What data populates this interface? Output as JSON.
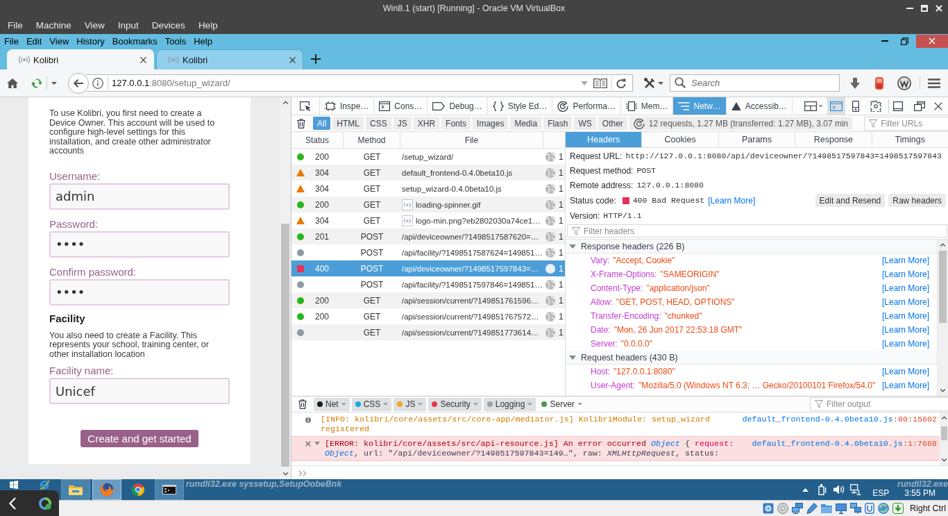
{
  "vm_window": {
    "title": "Win8.1 (start) [Running] - Oracle VM VirtualBox",
    "menu": [
      "File",
      "Machine",
      "View",
      "Input",
      "Devices",
      "Help"
    ]
  },
  "browser": {
    "menu": [
      "File",
      "Edit",
      "View",
      "History",
      "Bookmarks",
      "Tools",
      "Help"
    ],
    "tabs": [
      {
        "label": "Kolibri",
        "selected": true
      },
      {
        "label": "Kolibri",
        "selected": false
      }
    ],
    "address": {
      "host": "127.0.0.1",
      "rest": ":8080/setup_wizard/"
    },
    "search": {
      "placeholder": "Search"
    }
  },
  "setup_form": {
    "intro": "To use Kolibri, you first need to create a Device Owner. This account will be used to configure high-level settings for this installation, and create other administrator accounts",
    "owner_fields": [
      {
        "label": "Username:",
        "value": "admin"
      },
      {
        "label": "Password:",
        "value": "••••"
      },
      {
        "label": "Confirm password:",
        "value": "••••"
      }
    ],
    "facility_heading": "Facility",
    "facility_text": "You also need to create a Facility. This represents your school, training center, or other installation location",
    "facility_fields": [
      {
        "label": "Facility name:",
        "value": "Unicef"
      }
    ],
    "submit": "Create and get started"
  },
  "devtools": {
    "tools": [
      {
        "label": "Inspe…",
        "selected": false
      },
      {
        "label": "Cons…",
        "selected": false
      },
      {
        "label": "Debug…",
        "selected": false
      },
      {
        "label": "Style Ed…",
        "selected": false
      },
      {
        "label": "Performa…",
        "selected": false
      },
      {
        "label": "Mem…",
        "selected": false
      },
      {
        "label": "Netw…",
        "selected": true
      },
      {
        "label": "Accessib…",
        "selected": false
      }
    ],
    "split_console_on": true,
    "type_filters": [
      {
        "label": "All",
        "selected": true
      },
      {
        "label": "HTML",
        "selected": false
      },
      {
        "label": "CSS",
        "selected": false
      },
      {
        "label": "JS",
        "selected": false
      },
      {
        "label": "XHR",
        "selected": false
      },
      {
        "label": "Fonts",
        "selected": false
      },
      {
        "label": "Images",
        "selected": false
      },
      {
        "label": "Media",
        "selected": false
      },
      {
        "label": "Flash",
        "selected": false
      },
      {
        "label": "WS",
        "selected": false
      },
      {
        "label": "Other",
        "selected": false
      }
    ],
    "summary": "12 requests, 1.27 MB (transferred: 1.27 MB), 3.07 min",
    "url_filter": {
      "placeholder": "Filter URLs"
    },
    "request_table": {
      "columns": [
        "Status",
        "Method",
        "File"
      ],
      "rows": [
        {
          "kind": "success",
          "status": "200",
          "method": "GET",
          "file": "/setup_wizard/",
          "thumbnail": false,
          "column_4": "1",
          "selected": false
        },
        {
          "kind": "redirect",
          "status": "304",
          "method": "GET",
          "file": "default_frontend-0.4.0beta10.js",
          "thumbnail": false,
          "column_4": "1",
          "selected": false
        },
        {
          "kind": "redirect",
          "status": "304",
          "method": "GET",
          "file": "setup_wizard-0.4.0beta10.js",
          "thumbnail": false,
          "column_4": "1",
          "selected": false
        },
        {
          "kind": "success",
          "status": "200",
          "method": "GET",
          "file": "loading-spinner.gif",
          "thumbnail": true,
          "column_4": "1",
          "selected": false
        },
        {
          "kind": "redirect",
          "status": "304",
          "method": "GET",
          "file": "logo-min.png?eb2802030a74ce1…",
          "thumbnail": true,
          "column_4": "1",
          "selected": false
        },
        {
          "kind": "success",
          "status": "201",
          "method": "POST",
          "file": "/api/deviceowner/?1498517587620=…",
          "thumbnail": false,
          "column_4": "1",
          "selected": false
        },
        {
          "kind": "pending",
          "method": "POST",
          "file": "/api/facility/?1498517587624=149851…",
          "thumbnail": false,
          "column_4": "1",
          "selected": false
        },
        {
          "kind": "error",
          "status": "400",
          "method": "POST",
          "file": "/api/deviceowner/?1498517597843=…",
          "thumbnail": false,
          "column_4": "1",
          "selected": true
        },
        {
          "kind": "pending",
          "method": "POST",
          "file": "/api/facility/?1498517597846=149851…",
          "thumbnail": false,
          "column_4": "1",
          "selected": false
        },
        {
          "kind": "success",
          "status": "200",
          "method": "GET",
          "file": "/api/session/current/?149851761596…",
          "thumbnail": false,
          "column_4": "1",
          "selected": false
        },
        {
          "kind": "success",
          "status": "200",
          "method": "GET",
          "file": "/api/session/current/?149851767572…",
          "thumbnail": false,
          "column_4": "1",
          "selected": false
        },
        {
          "kind": "pending",
          "method": "GET",
          "file": "/api/session/current/?149851773614…",
          "thumbnail": false,
          "column_4": "1",
          "selected": false
        }
      ]
    },
    "details": {
      "tabs": [
        {
          "label": "Headers",
          "selected": true
        },
        {
          "label": "Cookies",
          "selected": false
        },
        {
          "label": "Params",
          "selected": false
        },
        {
          "label": "Response",
          "selected": false
        },
        {
          "label": "Timings",
          "selected": false
        }
      ],
      "summary": [
        {
          "label": "Request URL:",
          "value": "http://127.0.0.1:8080/api/deviceowner/?1498517597843=1498517597843"
        },
        {
          "label": "Request method:",
          "value": "POST"
        },
        {
          "label": "Remote address:",
          "value": "127.0.0.1:8080"
        }
      ],
      "status": {
        "label": "Status code:",
        "value": "400 Bad Request",
        "link": "[Learn More]"
      },
      "actions": [
        "Edit and Resend",
        "Raw headers"
      ],
      "version": {
        "label": "Version:",
        "value": "HTTP/1.1"
      },
      "header_filter": {
        "placeholder": "Filter headers"
      },
      "sections": [
        {
          "title": "Response headers (226 B)",
          "expanded": true,
          "headers": [
            {
              "name": "Vary:",
              "value": "\"Accept, Cookie\"",
              "link": "[Learn More]"
            },
            {
              "name": "X-Frame-Options:",
              "value": "\"SAMEORIGIN\"",
              "link": "[Learn More]"
            },
            {
              "name": "Content-Type:",
              "value": "\"application/json\"",
              "link": "[Learn More]"
            },
            {
              "name": "Allow:",
              "value": "\"GET, POST, HEAD, OPTIONS\"",
              "link": "[Learn More]"
            },
            {
              "name": "Transfer-Encoding:",
              "value": "\"chunked\"",
              "link": "[Learn More]"
            },
            {
              "name": "Date:",
              "value": "\"Mon, 26 Jun 2017 22:53:18 GMT\"",
              "link": "[Learn More]"
            },
            {
              "name": "Server:",
              "value": "\"0.0.0.0\"",
              "link": "[Learn More]"
            }
          ]
        },
        {
          "title": "Request headers (430 B)",
          "expanded": true,
          "headers": [
            {
              "name": "Host:",
              "value": "\"127.0.0.1:8080\"",
              "link": "[Learn More]"
            },
            {
              "name": "User-Agent:",
              "value": "\"Mozilla/5.0 (Windows NT 6.3; … Gecko/20100101 Firefox/54.0\"",
              "link": "[Learn More]"
            }
          ]
        }
      ]
    },
    "console": {
      "filters": [
        {
          "label": "Net",
          "color": "#1a1a1a",
          "on": true
        },
        {
          "label": "CSS",
          "color": "#1ca8e0",
          "on": true
        },
        {
          "label": "JS",
          "color": "#f5a623",
          "on": true
        },
        {
          "label": "Security",
          "color": "#e2394a",
          "on": true
        },
        {
          "label": "Logging",
          "color": "#a0a0a0",
          "on": true
        },
        {
          "label": "Server",
          "color": "#4a9a4a",
          "on": false
        }
      ],
      "output_filter": {
        "placeholder": "Filter output"
      },
      "messages": [
        {
          "kind": "info",
          "parts": [
            {
              "kind": "message",
              "text": "[INFO: kolibri/core/assets/src/core-app/mediator.js] KolibriModule: setup_wizard registered"
            }
          ],
          "source": "default_frontend-0.4.0beta10.js",
          "location": ":80:15602"
        },
        {
          "kind": "error",
          "expanded": true,
          "parts": [
            {
              "kind": "message",
              "text": "[ERROR: kolibri/core/assets/src/api-resource.js] An error occurred "
            },
            {
              "kind": "object",
              "text": "Object"
            },
            {
              "kind": "syntax",
              "text": " { "
            },
            {
              "kind": "property",
              "text": "request:"
            },
            {
              "kind": "object",
              "text": " Object"
            },
            {
              "kind": "syntax",
              "text": ", url: \"/api/deviceowner/?1498517597843=149…\", raw: "
            },
            {
              "kind": "type",
              "text": "XMLHttpRequest"
            },
            {
              "kind": "syntax",
              "text": ", status:"
            }
          ],
          "source": "default_frontend-0.4.0beta10.js",
          "location": ":1:7668"
        }
      ]
    }
  },
  "taskbar": {
    "apps": [
      {
        "running": false,
        "selected": false
      },
      {
        "running": true,
        "selected": false
      },
      {
        "running": true,
        "selected": true
      },
      {
        "running": false,
        "selected": false
      },
      {
        "running": true,
        "selected": false
      }
    ],
    "overlay_left": "rundll32.exe syssetup,SetupOobeBnk",
    "overlay_right": "rundll32.exe",
    "language": "ESP",
    "time": "3:55 PM"
  },
  "vm_status": {
    "host_key": "Right Ctrl"
  }
}
